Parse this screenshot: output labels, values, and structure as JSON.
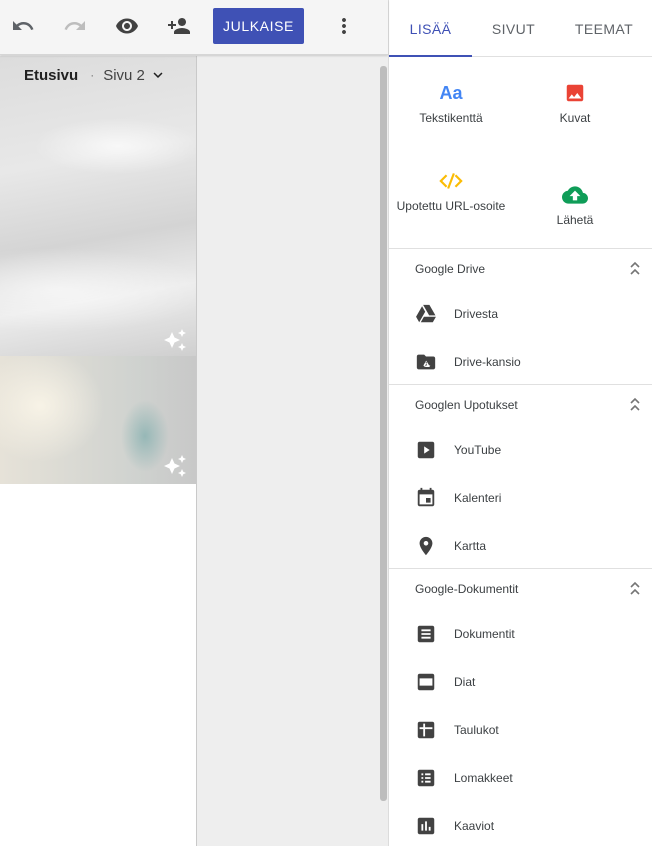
{
  "toolbar": {
    "undo_icon": "undo-icon",
    "redo_icon": "redo-icon",
    "preview_icon": "eye-icon",
    "share_icon": "person-add-icon",
    "publish_label": "JULKAISE",
    "more_icon": "more-vert-icon",
    "publish_color": "#3f51b5"
  },
  "page_nav": {
    "current": "Etusivu",
    "separator": "·",
    "next": "Sivu 2"
  },
  "panel": {
    "tabs": [
      {
        "label": "LISÄÄ",
        "active": true
      },
      {
        "label": "SIVUT",
        "active": false
      },
      {
        "label": "TEEMAT",
        "active": false
      }
    ],
    "insert_tiles": [
      {
        "label": "Tekstikenttä",
        "icon": "text-aa-icon",
        "icon_text": "Aa"
      },
      {
        "label": "Kuvat",
        "icon": "image-icon"
      },
      {
        "label": "Upotettu URL-osoite",
        "icon": "embed-code-icon"
      },
      {
        "label": "Lähetä",
        "icon": "upload-cloud-icon"
      }
    ],
    "sections": [
      {
        "title": "Google Drive",
        "items": [
          {
            "label": "Drivesta",
            "icon": "drive-icon"
          },
          {
            "label": "Drive-kansio",
            "icon": "drive-folder-icon"
          }
        ]
      },
      {
        "title": "Googlen Upotukset",
        "items": [
          {
            "label": "YouTube",
            "icon": "youtube-icon"
          },
          {
            "label": "Kalenteri",
            "icon": "calendar-icon"
          },
          {
            "label": "Kartta",
            "icon": "map-pin-icon"
          }
        ]
      },
      {
        "title": "Google-Dokumentit",
        "items": [
          {
            "label": "Dokumentit",
            "icon": "docs-icon"
          },
          {
            "label": "Diat",
            "icon": "slides-icon"
          },
          {
            "label": "Taulukot",
            "icon": "sheets-icon"
          },
          {
            "label": "Lomakkeet",
            "icon": "forms-icon"
          },
          {
            "label": "Kaaviot",
            "icon": "charts-icon"
          }
        ]
      }
    ]
  },
  "colors": {
    "accent": "#3f51b5",
    "text_tile_blue": "#4285f4",
    "image_red": "#ea4335",
    "embed_yellow": "#fbbc04",
    "upload_green": "#0f9d58"
  }
}
